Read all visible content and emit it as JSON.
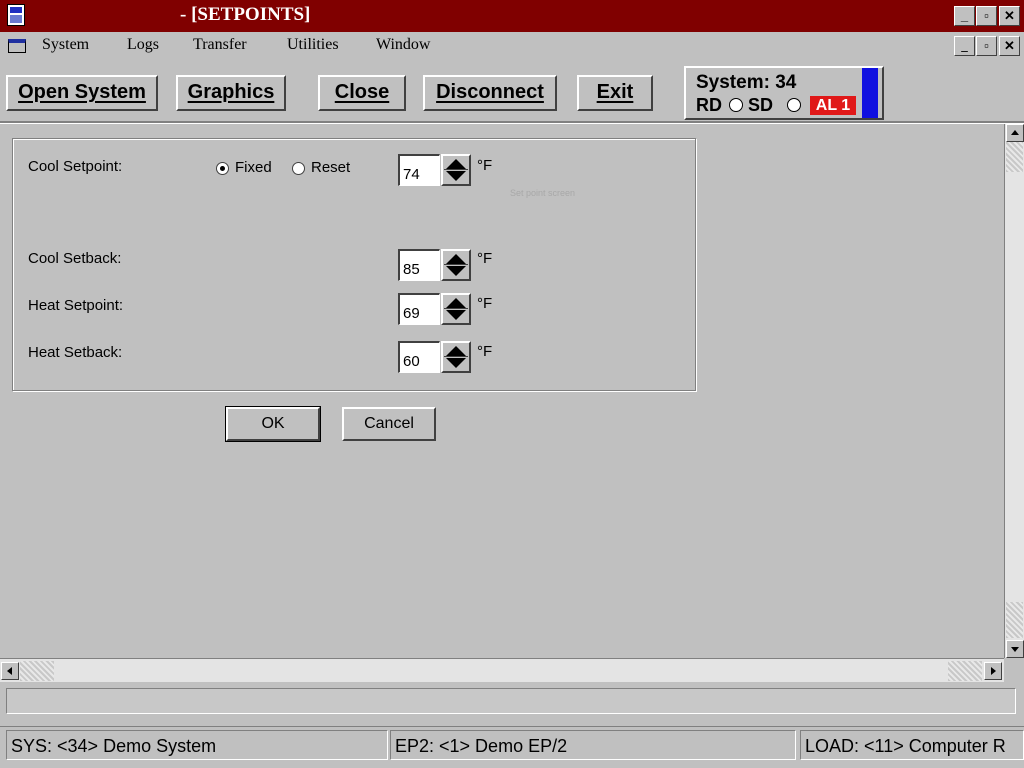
{
  "window": {
    "title": "- [SETPOINTS]"
  },
  "menu": {
    "items": [
      "System",
      "Logs",
      "Transfer",
      "Utilities",
      "Window"
    ]
  },
  "toolbar": {
    "open_system": "Open System",
    "graphics": "Graphics",
    "close": "Close",
    "disconnect": "Disconnect",
    "exit": "Exit"
  },
  "status_panel": {
    "system": "System: 34",
    "rd": "RD",
    "sd": "SD",
    "alarm": "AL 1",
    "alarm_color": "#e01818",
    "indicator_color": "#1010e0"
  },
  "setpoints": {
    "cool_setpoint": {
      "label": "Cool Setpoint:",
      "value": "74",
      "unit": "°F"
    },
    "mode": {
      "fixed": "Fixed",
      "reset": "Reset",
      "selected": "Fixed"
    },
    "ghost_text": "Set point screen",
    "cool_setback": {
      "label": "Cool Setback:",
      "value": "85",
      "unit": "°F"
    },
    "heat_setpoint": {
      "label": "Heat Setpoint:",
      "value": "69",
      "unit": "°F"
    },
    "heat_setback": {
      "label": "Heat Setback:",
      "value": "60",
      "unit": "°F"
    }
  },
  "dialog": {
    "ok": "OK",
    "cancel": "Cancel"
  },
  "statusbar": {
    "sys": "SYS: <34> Demo System",
    "ep": "EP2: <1> Demo EP/2",
    "load": "LOAD: <11> Computer R"
  },
  "icons": [
    "app-icon",
    "document-icon",
    "minimize-icon",
    "restore-icon",
    "close-icon",
    "spin-up-icon",
    "spin-down-icon",
    "scroll-up-icon",
    "scroll-down-icon",
    "scroll-left-icon",
    "scroll-right-icon"
  ]
}
